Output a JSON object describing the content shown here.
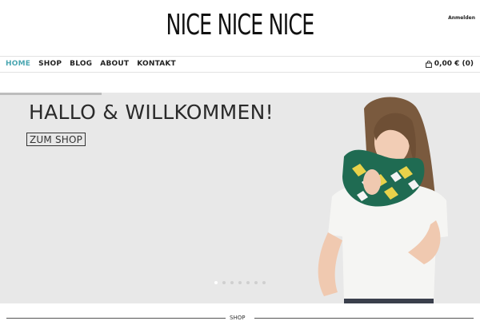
{
  "header": {
    "logo_text": "NICE NICE NICE",
    "login_label": "Anmelden"
  },
  "nav": {
    "items": [
      {
        "label": "HOME",
        "active": true
      },
      {
        "label": "SHOP",
        "active": false
      },
      {
        "label": "BLOG",
        "active": false
      },
      {
        "label": "ABOUT",
        "active": false
      },
      {
        "label": "KONTAKT",
        "active": false
      }
    ],
    "cart_label": "0,00 € (0)",
    "cart_icon": "shopping-bag-icon"
  },
  "hero": {
    "title": "HALLO & WILLKOMMEN!",
    "button_label": "ZUM SHOP",
    "slides_total": 7,
    "active_slide": 1
  },
  "section": {
    "label": "SHOP"
  },
  "colors": {
    "accent": "#4aa6b1",
    "hero_bg": "#e8e8e8"
  }
}
